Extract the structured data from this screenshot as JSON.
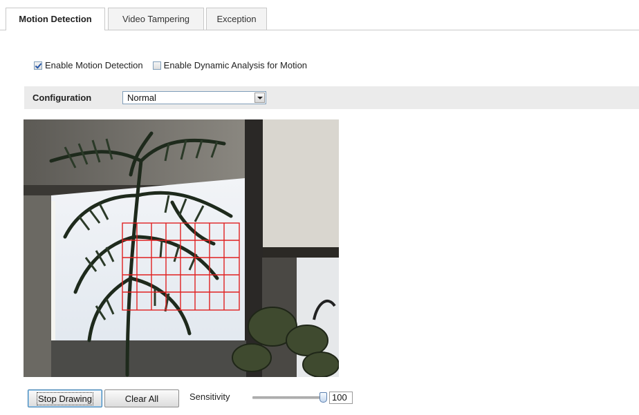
{
  "tabs": [
    {
      "label": "Motion Detection",
      "active": true
    },
    {
      "label": "Video Tampering",
      "active": false
    },
    {
      "label": "Exception",
      "active": false
    }
  ],
  "options": {
    "enable_motion_detection": {
      "label": "Enable Motion Detection",
      "checked": true
    },
    "enable_dynamic_analysis": {
      "label": "Enable Dynamic Analysis for Motion",
      "checked": false
    }
  },
  "configuration": {
    "label": "Configuration",
    "selected": "Normal"
  },
  "video": {
    "detection_grid": {
      "columns": 8,
      "rows": 5,
      "color": "#e02020"
    }
  },
  "controls": {
    "stop_drawing_label": "Stop Drawing",
    "clear_all_label": "Clear All",
    "sensitivity_label": "Sensitivity",
    "sensitivity_value": "100",
    "sensitivity_fraction": 1.0
  },
  "colors": {
    "tab_border": "#c8c8c8",
    "config_bar_bg": "#ebebeb",
    "grid_line": "#e02020",
    "focus_border": "#3c7fb1"
  }
}
